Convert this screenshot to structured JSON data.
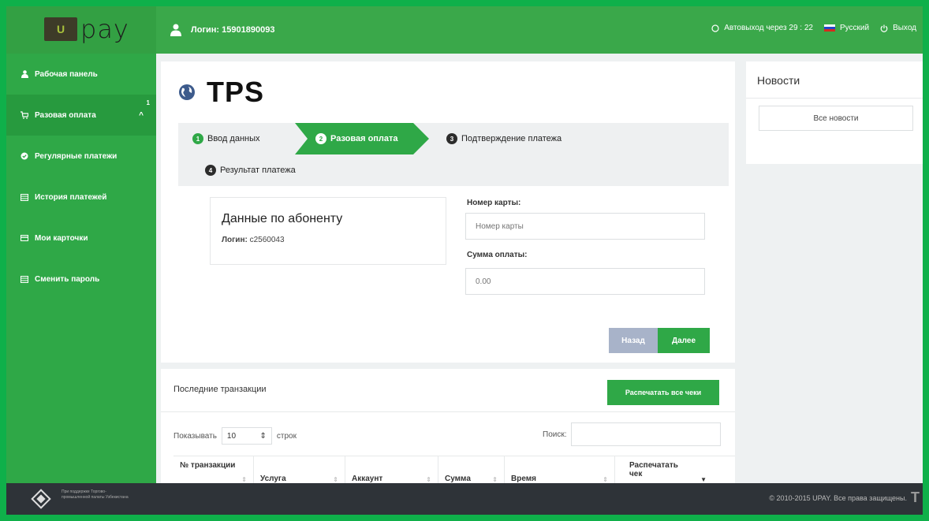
{
  "header": {
    "logo_text": "pay",
    "logo_mark": "U",
    "user_label": "Логин: 15901890093",
    "auto_logout": "Автовыход через 29 : 22",
    "language": "Русский",
    "logout": "Выход"
  },
  "sidebar": {
    "items": [
      {
        "label": "Рабочая панель",
        "icon": "user-icon"
      },
      {
        "label": "Разовая оплата",
        "icon": "cart-icon",
        "badge": "1"
      },
      {
        "label": "Регулярные платежи",
        "icon": "check-circle-icon"
      },
      {
        "label": "История платежей",
        "icon": "table-icon"
      },
      {
        "label": "Мои карточки",
        "icon": "card-icon"
      },
      {
        "label": "Сменить пароль",
        "icon": "table-icon"
      }
    ]
  },
  "main": {
    "title": "TPS",
    "steps": [
      {
        "num": "1",
        "label": "Ввод данных"
      },
      {
        "num": "2",
        "label": "Разовая оплата"
      },
      {
        "num": "3",
        "label": "Подтверждение платежа"
      },
      {
        "num": "4",
        "label": "Результат платежа"
      }
    ],
    "subscriber": {
      "title": "Данные по абоненту",
      "login_label": "Логин:",
      "login_value": "c2560043"
    },
    "card_label": "Номер карты:",
    "card_placeholder": "Номер карты",
    "amount_label": "Сумма оплаты:",
    "amount_placeholder": "0.00",
    "back_button": "Назад",
    "next_button": "Далее"
  },
  "transactions": {
    "title": "Последние транзакции",
    "print_all": "Распечатать все чеки",
    "show_label": "Показывать",
    "show_value": "10",
    "rows_label": "строк",
    "search_label": "Поиск:",
    "columns": [
      "№ транзакции",
      "Услуга",
      "Аккаунт",
      "Сумма",
      "Время",
      "Распечатать чек"
    ]
  },
  "news": {
    "title": "Новости",
    "all_news": "Все новости"
  },
  "footer": {
    "small_text": "При поддержке Торгово-промышленной палаты Узбекистана",
    "copyright": "© 2010-2015 UPAY. Все права защищены.",
    "t_mark": "T"
  },
  "colors": {
    "brand_green": "#2fa847",
    "footer_dark": "#2e3338",
    "back_button": "#a8b3c9"
  }
}
